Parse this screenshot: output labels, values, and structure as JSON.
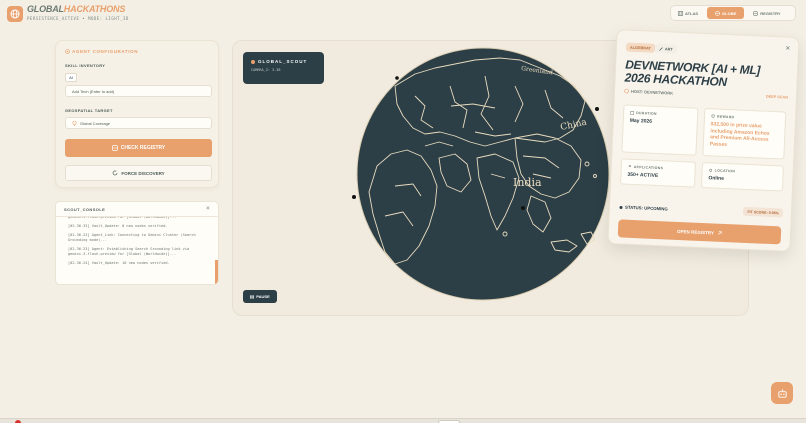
{
  "brand": {
    "title_part1": "GLOBAL",
    "title_part2": "HACKATHONS",
    "subtitle": "PERSISTENCE_ACTIVE • MODE: LIGHT_3D"
  },
  "nav": {
    "atlas": "ATLAS",
    "globe": "GLOBE",
    "registry": "REGISTRY",
    "active": "globe"
  },
  "agent": {
    "panel_title": "AGENT CONFIGURATION",
    "skill_label": "SKILL INVENTORY",
    "skill_chip": "AI",
    "tech_placeholder": "Add Tech (Enter to add)",
    "geo_label": "GEOSPATIAL TARGET",
    "geo_value": "Global Coverage",
    "check_button": "CHECK REGISTRY",
    "force_button": "FORCE DISCOVERY"
  },
  "console": {
    "title": "SCOUT_CONSOLE",
    "close": "×",
    "lines": [
      "gemini-3-flash-preview for [Global (Worldwide)]...",
      "[02.36.33] Vault_Update: 0 new nodes verified.",
      "[02.36.23] Agent_Link: Connecting to Gemini Cluster (Search Grounding mode)...",
      "[02.36.23] Agent: Establishing Search Grounding link via gemini-3-flash-preview for [Global (Worldwide)]...",
      "[02.36.24] Vault_Update: 10 new nodes verified."
    ]
  },
  "scout": {
    "title": "GLOBAL_SCOUT",
    "camera": "CAMERA_Z: 3.38",
    "pause": "PAUSE"
  },
  "globe": {
    "labels": [
      "Greenland",
      "China",
      "India"
    ],
    "ocean_color": "#2c3e46",
    "land_stroke": "#e9dcc0"
  },
  "detail": {
    "close": "×",
    "tag_primary": "ALGEBRAT",
    "tag_secondary": "ART",
    "title": "DEVNETWORK [AI + ML] 2026 HACKATHON",
    "host": "HOST: DEVNETWORK",
    "deep_scan": "DEEP SCAN",
    "duration_label": "DURATION",
    "duration_value": "May 2026",
    "reward_label": "REWARD",
    "reward_value": "$32,500 in prize value including Amazon Echos and Premium All-Access Passes",
    "applications_label": "APPLICATIONS",
    "applications_value": "350+ ACTIVE",
    "location_label": "LOCATION",
    "location_value": "Online",
    "status": "STATUS: UPCOMING",
    "fit_score": "FIT SCORE: 0.95%",
    "open_button": "OPEN REGISTRY"
  },
  "colors": {
    "accent": "#e8a06d",
    "dark": "#2c3e46",
    "background": "#f4efe4"
  }
}
